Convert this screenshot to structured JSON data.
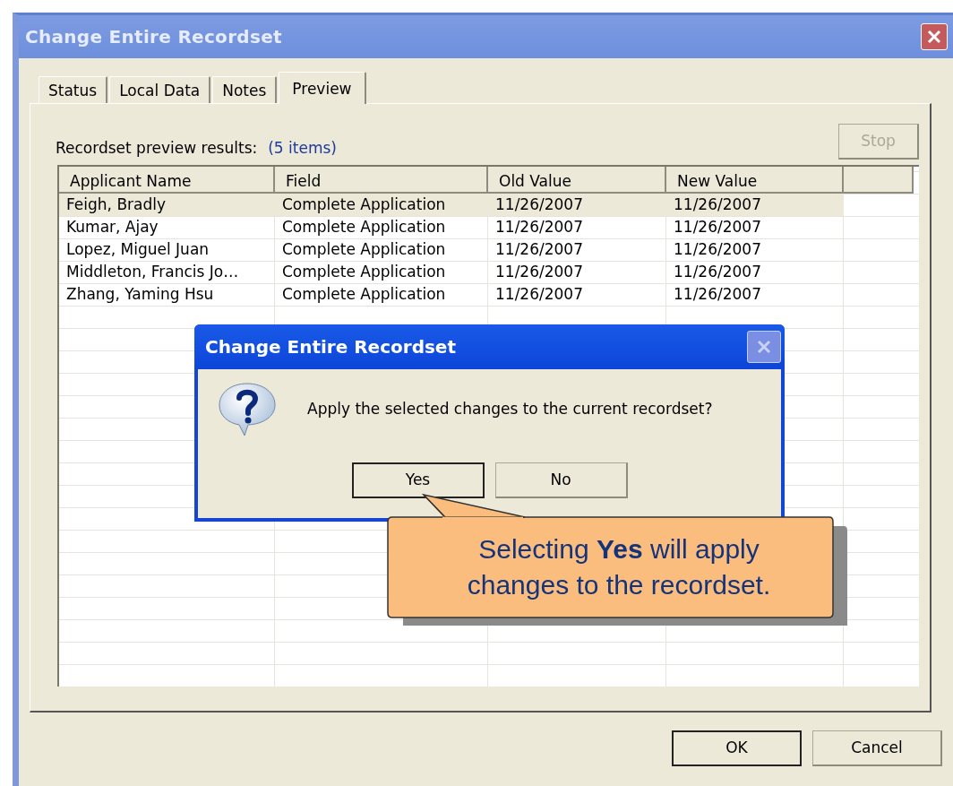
{
  "window": {
    "title": "Change Entire Recordset"
  },
  "tabs": [
    {
      "label": "Status",
      "selected": false
    },
    {
      "label": "Local Data",
      "selected": false
    },
    {
      "label": "Notes",
      "selected": false
    },
    {
      "label": "Preview",
      "selected": true
    }
  ],
  "preview": {
    "label": "Recordset preview results:",
    "count": "(5 items)",
    "stop_button": {
      "label": "Stop",
      "disabled": true
    }
  },
  "table": {
    "columns": [
      "Applicant Name",
      "Field",
      "Old Value",
      "New Value"
    ],
    "rows": [
      {
        "cells": [
          "Feigh, Bradly",
          "Complete Application",
          "11/26/2007",
          "11/26/2007"
        ],
        "selected": true
      },
      {
        "cells": [
          "Kumar, Ajay",
          "Complete Application",
          "11/26/2007",
          "11/26/2007"
        ],
        "selected": false
      },
      {
        "cells": [
          "Lopez, Miguel Juan",
          "Complete Application",
          "11/26/2007",
          "11/26/2007"
        ],
        "selected": false
      },
      {
        "cells": [
          "Middleton, Francis Jo…",
          "Complete Application",
          "11/26/2007",
          "11/26/2007"
        ],
        "selected": false
      },
      {
        "cells": [
          "Zhang, Yaming Hsu",
          "Complete Application",
          "11/26/2007",
          "11/26/2007"
        ],
        "selected": false
      }
    ]
  },
  "buttons": [
    {
      "label": "OK",
      "default": true
    },
    {
      "label": "Cancel",
      "default": false
    }
  ],
  "message_box": {
    "title": "Change Entire Recordset",
    "message": "Apply the selected changes to the current recordset?",
    "buttons": [
      {
        "label": "Yes",
        "default": true
      },
      {
        "label": "No",
        "default": false
      }
    ]
  },
  "callout": {
    "text": "Selecting **Yes** will apply changes to the recordset."
  }
}
